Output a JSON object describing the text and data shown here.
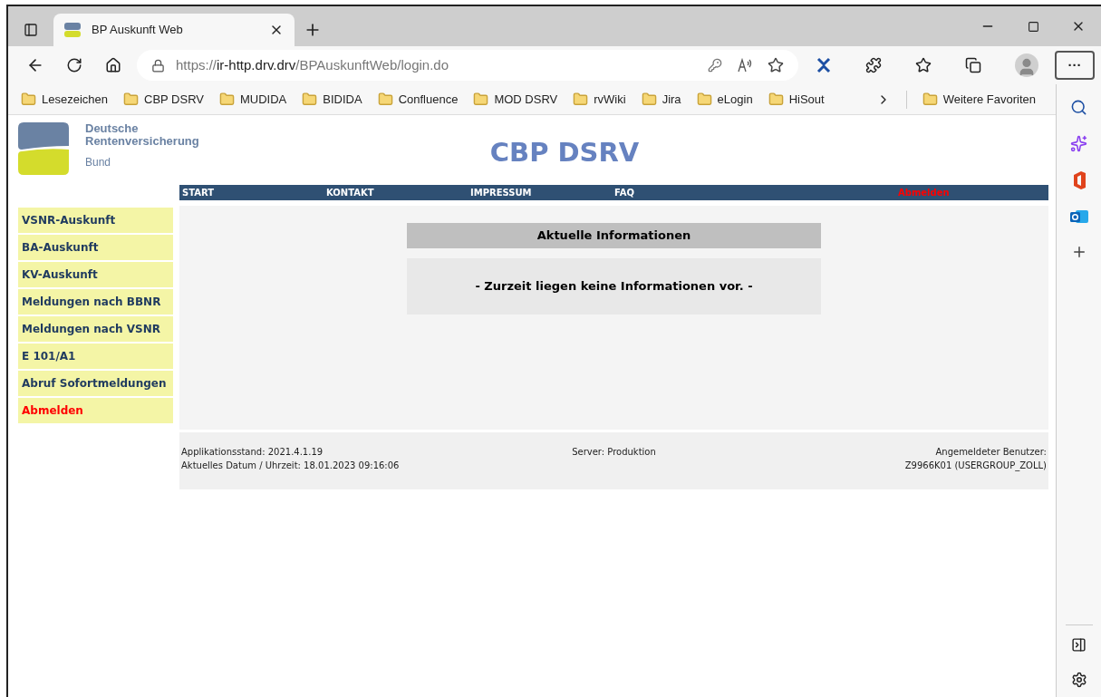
{
  "browser": {
    "tab_title": "BP Auskunft Web",
    "url": {
      "scheme": "https://",
      "host": "ir-http.drv.drv",
      "path": "/BPAuskunftWeb/login.do"
    },
    "bookmarks": [
      "Lesezeichen",
      "CBP DSRV",
      "MUDIDA",
      "BIDIDA",
      "Confluence",
      "MOD DSRV",
      "rvWiki",
      "Jira",
      "eLogin",
      "HiSout"
    ],
    "more_bookmarks": "Weitere Favoriten",
    "menu_button": "···"
  },
  "page": {
    "logo": {
      "line_1": "Deutsche",
      "line_2": "Rentenversicherung",
      "line_3": "Bund"
    },
    "title": "CBP DSRV",
    "nav": [
      {
        "label": "START",
        "kind": "link"
      },
      {
        "label": "KONTAKT",
        "kind": "link"
      },
      {
        "label": "IMPRESSUM",
        "kind": "link"
      },
      {
        "label": "FAQ",
        "kind": "link"
      },
      {
        "label": "Abmelden",
        "kind": "logout"
      }
    ],
    "menu": [
      {
        "label": "VSNR-Auskunft",
        "kind": "link"
      },
      {
        "label": "BA-Auskunft",
        "kind": "link"
      },
      {
        "label": "KV-Auskunft",
        "kind": "link"
      },
      {
        "label": "Meldungen nach BBNR",
        "kind": "link"
      },
      {
        "label": "Meldungen nach VSNR",
        "kind": "link"
      },
      {
        "label": "E 101/A1",
        "kind": "link"
      },
      {
        "label": "Abruf Sofortmeldungen",
        "kind": "link"
      },
      {
        "label": "Abmelden",
        "kind": "logout"
      }
    ],
    "info": {
      "heading": "Aktuelle Informationen",
      "message": "- Zurzeit liegen keine Informationen vor. -"
    },
    "footer": {
      "version": "Applikationsstand: 2021.4.1.19",
      "datetime": "Aktuelles Datum / Uhrzeit: 18.01.2023 09:16:06",
      "server": "Server: Produktion",
      "user_label": "Angemeldeter Benutzer:",
      "user": "Z9966K01 (USERGROUP_ZOLL)"
    }
  }
}
